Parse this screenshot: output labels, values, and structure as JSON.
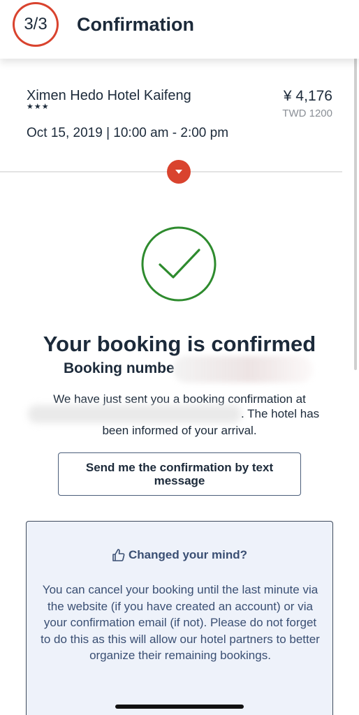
{
  "header": {
    "step": "3/3",
    "title": "Confirmation"
  },
  "summary": {
    "hotel_name": "Ximen Hedo Hotel Kaifeng",
    "stars": "★★★",
    "price": "¥ 4,176",
    "price_secondary": "TWD 1200",
    "date_time": "Oct 15, 2019 | 10:00 am - 2:00 pm"
  },
  "confirmation": {
    "title": "Your booking is confirmed",
    "booking_number_label": "Booking numbe",
    "sent_line1": "We have just sent you a booking confirmation at",
    "sent_line2": ". The hotel has",
    "sent_line3": "been informed of your arrival.",
    "sms_button": "Send me the confirmation by text message"
  },
  "changed_mind": {
    "title": "Changed your mind?",
    "body": "You can cancel your booking until the last minute via the website (if you have created an account) or via your confirmation email (if not). Please do not forget to do this as this will allow our hotel partners to better organize their remaining bookings."
  },
  "colors": {
    "accent_red": "#d9432e",
    "success_green": "#2e8b2e",
    "navy": "#1c2a3a",
    "panel_bg": "#eef2fa"
  }
}
